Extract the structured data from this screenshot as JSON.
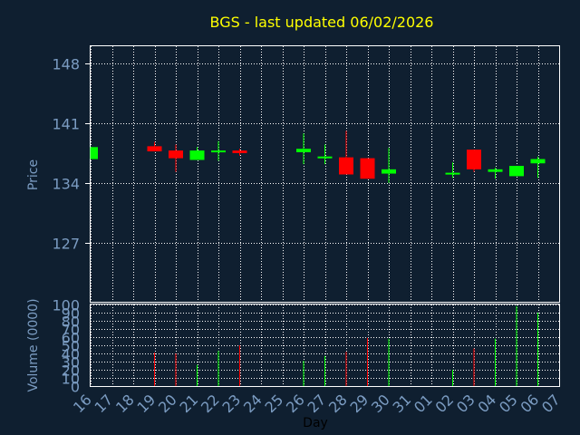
{
  "chart_data": {
    "type": "candlestick",
    "title": "BGS - last updated 06/02/2026",
    "xlabel": "Day",
    "price_panel": {
      "ylabel": "Price",
      "ylim": [
        120,
        150
      ],
      "yticks": [
        127,
        134,
        141,
        148
      ],
      "grid": true
    },
    "volume_panel": {
      "ylabel": "Volume (0000)",
      "ylim": [
        0,
        100
      ],
      "yticks": [
        0,
        10,
        20,
        30,
        40,
        50,
        60,
        70,
        80,
        90,
        100
      ],
      "grid": true
    },
    "x_tick_labels": [
      "16",
      "17",
      "18",
      "19",
      "20",
      "21",
      "22",
      "23",
      "24",
      "25",
      "26",
      "27",
      "28",
      "29",
      "30",
      "31",
      "01",
      "02",
      "03",
      "04",
      "05",
      "06",
      "07"
    ],
    "colors": {
      "up": "#00ff00",
      "down": "#ff0000",
      "grid": "#ffffff",
      "title": "#ffff00",
      "axis_text": "#7b9cc2",
      "background": "#0f1f30"
    },
    "candles": [
      {
        "day": "16",
        "open": 136.8,
        "high": 138.2,
        "low": 136.8,
        "close": 138.2,
        "volume": 0
      },
      {
        "day": "19",
        "open": 138.3,
        "high": 138.8,
        "low": 137.7,
        "close": 137.7,
        "volume": 41
      },
      {
        "day": "20",
        "open": 137.8,
        "high": 138.5,
        "low": 135.3,
        "close": 136.9,
        "volume": 40
      },
      {
        "day": "21",
        "open": 136.7,
        "high": 138.2,
        "low": 136.7,
        "close": 137.8,
        "volume": 26
      },
      {
        "day": "22",
        "open": 137.6,
        "high": 138.9,
        "low": 136.6,
        "close": 137.8,
        "volume": 43
      },
      {
        "day": "23",
        "open": 137.8,
        "high": 138.0,
        "low": 137.2,
        "close": 137.5,
        "volume": 50
      },
      {
        "day": "26",
        "open": 137.6,
        "high": 139.8,
        "low": 136.2,
        "close": 138.0,
        "volume": 31
      },
      {
        "day": "27",
        "open": 136.9,
        "high": 138.5,
        "low": 136.2,
        "close": 137.1,
        "volume": 37
      },
      {
        "day": "28",
        "open": 137.0,
        "high": 140.1,
        "low": 135.0,
        "close": 135.0,
        "volume": 42
      },
      {
        "day": "29",
        "open": 136.9,
        "high": 136.9,
        "low": 134.5,
        "close": 134.5,
        "volume": 59
      },
      {
        "day": "30",
        "open": 135.1,
        "high": 138.1,
        "low": 134.0,
        "close": 135.6,
        "volume": 58
      },
      {
        "day": "02",
        "open": 135.0,
        "high": 136.4,
        "low": 134.6,
        "close": 135.2,
        "volume": 20
      },
      {
        "day": "03",
        "open": 137.9,
        "high": 137.9,
        "low": 135.3,
        "close": 135.6,
        "volume": 46
      },
      {
        "day": "04",
        "open": 135.3,
        "high": 135.8,
        "low": 134.5,
        "close": 135.6,
        "volume": 58
      },
      {
        "day": "05",
        "open": 134.8,
        "high": 136.0,
        "low": 134.8,
        "close": 136.0,
        "volume": 98
      },
      {
        "day": "06",
        "open": 136.3,
        "high": 137.1,
        "low": 134.6,
        "close": 136.8,
        "volume": 90
      }
    ]
  }
}
